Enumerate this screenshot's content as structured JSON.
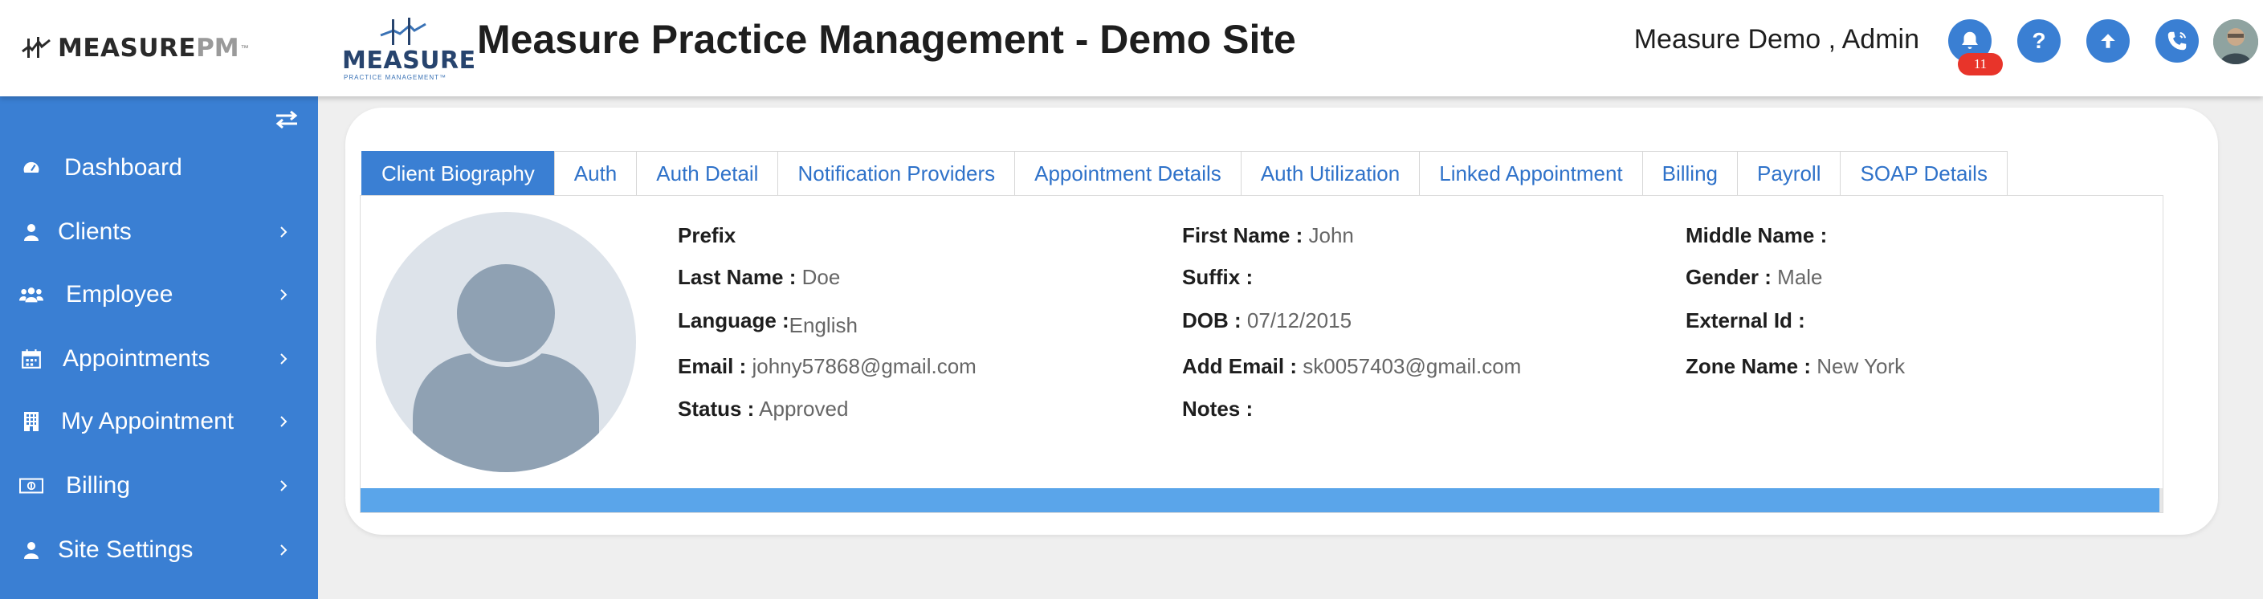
{
  "brand": {
    "main": "MEASURE",
    "accent": "PM",
    "tm": "™"
  },
  "site_logo": {
    "word": "MEASURE",
    "sub": "PRACTICE MANAGEMENT™"
  },
  "header": {
    "title": "Measure Practice Management - Demo Site",
    "user": "Measure Demo , Admin",
    "notification_count": "11",
    "help_label": "?"
  },
  "sidebar": {
    "items": [
      {
        "label": "Dashboard",
        "icon": "dashboard-icon",
        "chevron": false
      },
      {
        "label": "Clients",
        "icon": "user-icon",
        "chevron": true
      },
      {
        "label": "Employee",
        "icon": "users-icon",
        "chevron": true
      },
      {
        "label": "Appointments",
        "icon": "calendar-icon",
        "chevron": true
      },
      {
        "label": "My Appointment",
        "icon": "building-icon",
        "chevron": true
      },
      {
        "label": "Billing",
        "icon": "money-icon",
        "chevron": true
      },
      {
        "label": "Site Settings",
        "icon": "user-icon",
        "chevron": true
      }
    ]
  },
  "tabs": [
    "Client Biography",
    "Auth",
    "Auth Detail",
    "Notification Providers",
    "Appointment Details",
    "Auth Utilization",
    "Linked Appointment",
    "Billing",
    "Payroll",
    "SOAP Details"
  ],
  "active_tab": 0,
  "fields": {
    "prefix": {
      "label": "Prefix",
      "value": ""
    },
    "first_name": {
      "label": "First Name :",
      "value": "John"
    },
    "middle_name": {
      "label": "Middle Name :",
      "value": ""
    },
    "last_name": {
      "label": "Last Name :",
      "value": "Doe"
    },
    "suffix": {
      "label": "Suffix :",
      "value": ""
    },
    "gender": {
      "label": "Gender :",
      "value": "Male"
    },
    "language": {
      "label": "Language :",
      "value": "English"
    },
    "dob": {
      "label": "DOB :",
      "value": "07/12/2015"
    },
    "external_id": {
      "label": "External Id :",
      "value": ""
    },
    "email": {
      "label": "Email :",
      "value": "johny57868@gmail.com"
    },
    "add_email": {
      "label": "Add Email :",
      "value": "sk0057403@gmail.com"
    },
    "zone_name": {
      "label": "Zone Name :",
      "value": "New York"
    },
    "status": {
      "label": "Status :",
      "value": "Approved"
    },
    "notes": {
      "label": "Notes :",
      "value": ""
    }
  },
  "progress": {
    "fraction": 0.998
  },
  "colors": {
    "primary": "#3a7fd3",
    "badge": "#e8342a",
    "progress": "#5aa5ea"
  }
}
